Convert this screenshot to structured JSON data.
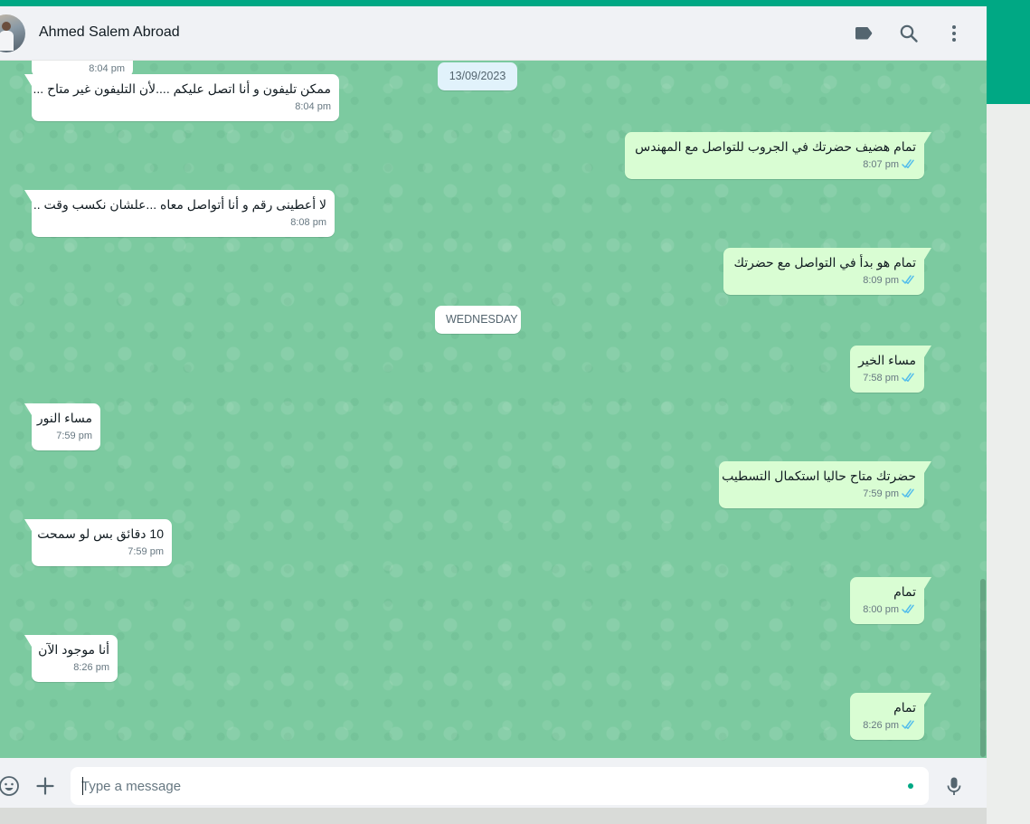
{
  "colors": {
    "brand": "#00a884",
    "incoming_bubble": "#ffffff",
    "outgoing_bubble": "#d9fdd3",
    "wallpaper": "#7ccaa0",
    "read_ticks": "#53bdeb"
  },
  "header": {
    "contact_name": "Ahmed Salem Abroad",
    "icons": [
      "label-icon",
      "search-icon",
      "menu-dots-icon"
    ]
  },
  "dividers": [
    {
      "label": "13/09/2023"
    },
    {
      "label": "WEDNESDAY"
    }
  ],
  "messages": [
    {
      "direction": "in",
      "text": "",
      "time": "8:04 pm",
      "partial": true
    },
    {
      "direction": "in",
      "text": "ممكن تليفون و أنا اتصل عليكم ....لأن التليفون غير متاح ...",
      "time": "8:04 pm"
    },
    {
      "direction": "out",
      "text": "تمام هضيف حضرتك في الجروب للتواصل مع المهندس",
      "time": "8:07 pm",
      "status": "read"
    },
    {
      "direction": "in",
      "text": "لا أعطينى رقم و أنا أتواصل معاه ...علشان نكسب وقت ..",
      "time": "8:08 pm"
    },
    {
      "direction": "out",
      "text": "تمام هو بدأ في التواصل مع حضرتك",
      "time": "8:09 pm",
      "status": "read"
    },
    {
      "direction": "out",
      "text": "مساء الخير",
      "time": "7:58 pm",
      "status": "read"
    },
    {
      "direction": "in",
      "text": "مساء النور",
      "time": "7:59 pm"
    },
    {
      "direction": "out",
      "text": "حضرتك متاح حاليا استكمال التسطيب",
      "time": "7:59 pm",
      "status": "read"
    },
    {
      "direction": "in",
      "text": "10 دقائق بس لو سمحت",
      "time": "7:59 pm"
    },
    {
      "direction": "out",
      "text": "تمام",
      "time": "8:00 pm",
      "status": "read"
    },
    {
      "direction": "in",
      "text": "أنا موجود الآن",
      "time": "8:26 pm"
    },
    {
      "direction": "out",
      "text": "تمام",
      "time": "8:26 pm",
      "status": "read"
    }
  ],
  "composer": {
    "placeholder": "Type a message",
    "icons": [
      "emoji-icon",
      "attach-plus-icon",
      "microphone-icon"
    ]
  }
}
